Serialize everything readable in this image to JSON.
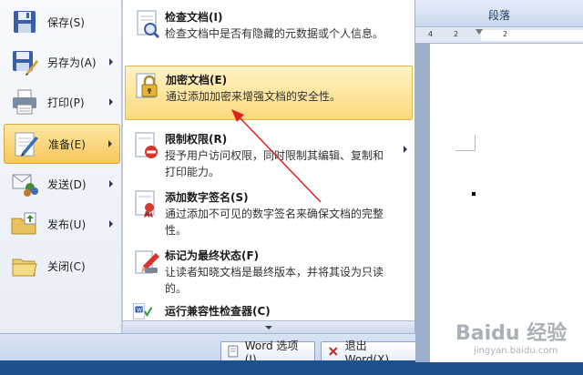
{
  "left_menu": {
    "items": [
      {
        "label": "保存(S)",
        "icon": "save-icon",
        "has_arrow": false
      },
      {
        "label": "另存为(A)",
        "icon": "save-as-icon",
        "has_arrow": true
      },
      {
        "label": "打印(P)",
        "icon": "printer-icon",
        "has_arrow": true
      },
      {
        "label": "准备(E)",
        "icon": "prepare-icon",
        "has_arrow": true,
        "active": true
      },
      {
        "label": "发送(D)",
        "icon": "send-icon",
        "has_arrow": true
      },
      {
        "label": "发布(U)",
        "icon": "publish-icon",
        "has_arrow": true
      },
      {
        "label": "关闭(C)",
        "icon": "close-folder-icon",
        "has_arrow": false
      }
    ]
  },
  "submenu": {
    "items": [
      {
        "title": "检查文档(I)",
        "desc": "检查文档中是否有隐藏的元数据或个人信息。",
        "icon": "inspect-document-icon"
      },
      {
        "title": "加密文档(E)",
        "desc": "通过添加加密来增强文档的安全性。",
        "icon": "encrypt-lock-icon",
        "active": true
      },
      {
        "title": "限制权限(R)",
        "desc": "授予用户访问权限，同时限制其编辑、复制和打印能力。",
        "icon": "restrict-permission-icon",
        "has_arrow": true
      },
      {
        "title": "添加数字签名(S)",
        "desc": "通过添加不可见的数字签名来确保文档的完整性。",
        "icon": "digital-signature-icon"
      },
      {
        "title": "标记为最终状态(F)",
        "desc": "让读者知晓文档是最终版本，并将其设为只读的。",
        "icon": "mark-final-icon"
      },
      {
        "title": "运行兼容性检查器(C)",
        "desc": "",
        "icon": "compatibility-checker-icon"
      }
    ]
  },
  "bottom_bar": {
    "options_label": "Word 选项(I)",
    "exit_label": "退出 Word(X)"
  },
  "ribbon": {
    "group_label": "段落"
  },
  "ruler": {
    "numbers": [
      "4",
      "2",
      "2"
    ]
  },
  "watermark": {
    "brand": "Baidu 经验",
    "url": "jingyan.baidu.com"
  },
  "colors": {
    "active_gradient_top": "#fde9a3",
    "active_gradient_bottom": "#f7c65a",
    "annotation_arrow": "#e02020"
  }
}
